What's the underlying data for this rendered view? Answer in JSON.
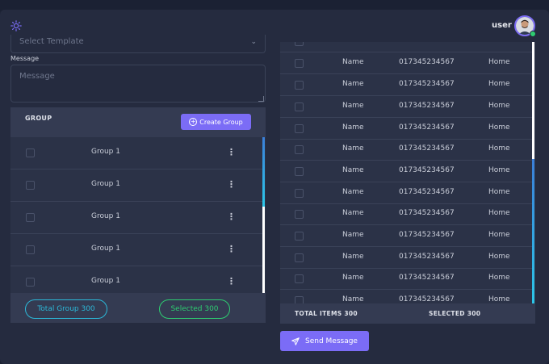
{
  "header": {
    "user_label": "user"
  },
  "template": {
    "placeholder": "Select Template"
  },
  "message": {
    "label": "Message",
    "placeholder": "Message"
  },
  "groups": {
    "title": "GROUP",
    "create_label": "Create Group",
    "items": [
      {
        "name": "Group 1"
      },
      {
        "name": "Group 1"
      },
      {
        "name": "Group 1"
      },
      {
        "name": "Group 1"
      },
      {
        "name": "Group 1"
      }
    ],
    "total_label": "Total Group 300",
    "selected_label": "Selected 300"
  },
  "contacts": {
    "rows": [
      {
        "name": "Name",
        "phone": "017345234567",
        "type": "Home"
      },
      {
        "name": "Name",
        "phone": "017345234567",
        "type": "Home"
      },
      {
        "name": "Name",
        "phone": "017345234567",
        "type": "Home"
      },
      {
        "name": "Name",
        "phone": "017345234567",
        "type": "Home"
      },
      {
        "name": "Name",
        "phone": "017345234567",
        "type": "Home"
      },
      {
        "name": "Name",
        "phone": "017345234567",
        "type": "Home"
      },
      {
        "name": "Name",
        "phone": "017345234567",
        "type": "Home"
      },
      {
        "name": "Name",
        "phone": "017345234567",
        "type": "Home"
      },
      {
        "name": "Name",
        "phone": "017345234567",
        "type": "Home"
      },
      {
        "name": "Name",
        "phone": "017345234567",
        "type": "Home"
      },
      {
        "name": "Name",
        "phone": "017345234567",
        "type": "Home"
      },
      {
        "name": "Name",
        "phone": "017345234567",
        "type": "Home"
      },
      {
        "name": "Name",
        "phone": "017345234567",
        "type": "Home"
      }
    ],
    "total_label": "TOTAL ITEMS 300",
    "selected_label": "SELECTED 300"
  },
  "send": {
    "label": "Send Message"
  },
  "colors": {
    "accent": "#7b6cf6",
    "total_pill": "#2cb8d8",
    "selected_pill": "#2ecc71",
    "online": "#2ecc71"
  },
  "icons": [
    "sun-icon",
    "avatar",
    "chevron-down-icon",
    "plus-circle-icon",
    "kebab-menu-icon",
    "send-icon"
  ]
}
